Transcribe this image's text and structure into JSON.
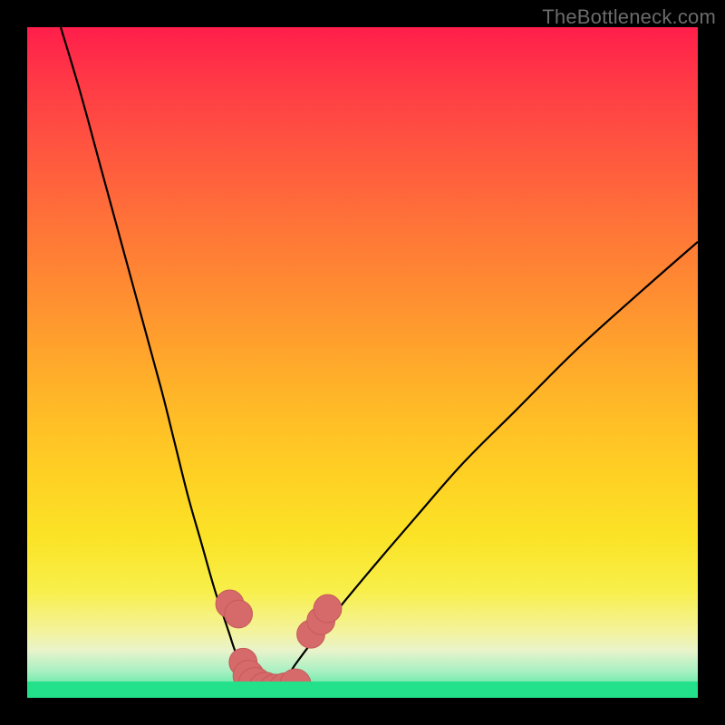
{
  "watermark": "TheBottleneck.com",
  "chart_data": {
    "type": "line",
    "title": "",
    "xlabel": "",
    "ylabel": "",
    "xlim": [
      0,
      100
    ],
    "ylim": [
      0,
      100
    ],
    "series": [
      {
        "name": "left-curve",
        "x": [
          5,
          8,
          11,
          14,
          17,
          20,
          22,
          24,
          26,
          28,
          30,
          31,
          32,
          33,
          34,
          35,
          36
        ],
        "values": [
          100,
          90,
          79,
          68,
          57,
          46,
          38,
          30,
          23,
          16,
          10,
          7,
          5,
          3,
          2,
          1.2,
          0.7
        ]
      },
      {
        "name": "right-curve",
        "x": [
          36,
          38,
          40,
          43,
          47,
          52,
          58,
          65,
          73,
          82,
          92,
          100
        ],
        "values": [
          0.7,
          2,
          5,
          9,
          14,
          20,
          27,
          35,
          43,
          52,
          61,
          68
        ]
      }
    ],
    "markers": [
      {
        "x": 30.2,
        "y": 14.0,
        "r": 1.4
      },
      {
        "x": 31.5,
        "y": 12.5,
        "r": 1.4
      },
      {
        "x": 32.2,
        "y": 5.3,
        "r": 1.4
      },
      {
        "x": 33.0,
        "y": 3.3,
        "r": 1.6
      },
      {
        "x": 34.0,
        "y": 2.0,
        "r": 1.8
      },
      {
        "x": 35.5,
        "y": 1.3,
        "r": 1.8
      },
      {
        "x": 37.0,
        "y": 1.0,
        "r": 1.8
      },
      {
        "x": 38.5,
        "y": 1.2,
        "r": 1.8
      },
      {
        "x": 40.0,
        "y": 2.0,
        "r": 1.6
      },
      {
        "x": 42.3,
        "y": 9.5,
        "r": 1.4
      },
      {
        "x": 43.8,
        "y": 11.5,
        "r": 1.4
      },
      {
        "x": 44.8,
        "y": 13.3,
        "r": 1.4
      }
    ],
    "colors": {
      "gradient_top": "#ff1e4b",
      "gradient_yellow": "#fbe326",
      "gradient_bottom": "#35e68e",
      "curve": "#000000",
      "marker": "#d66a6a",
      "frame": "#000000"
    }
  }
}
